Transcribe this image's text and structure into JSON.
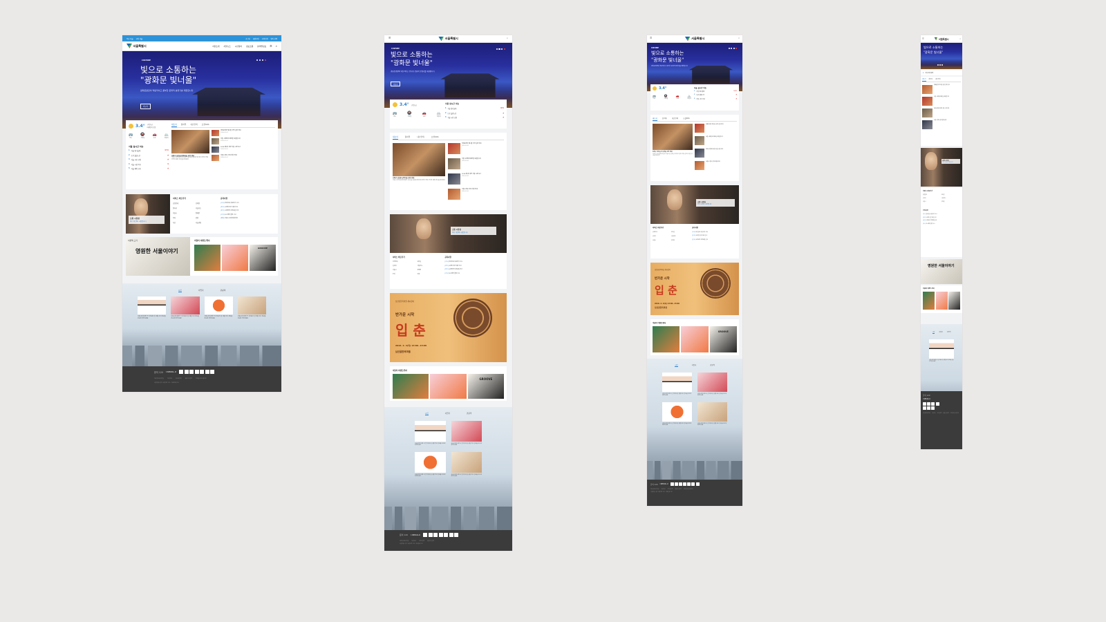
{
  "top_links": [
    "주요 서울",
    "국어 서울"
  ],
  "top_right_links": [
    "로그인",
    "회원가입",
    "사이트맵",
    "사이트맵",
    "언어 선택"
  ],
  "logo": "서울특별시",
  "gnb": [
    "서울소개",
    "서울뉴스",
    "시민참여",
    "정보소통",
    "분야별정보"
  ],
  "hero": {
    "tag": "CULTURE",
    "title_line1": "빛으로 소통하는",
    "title_line2": "\"광화문 빛너울\"",
    "desc": "광화문광장의 역동적이고 풍부한 문화적 분위기를 재현합니다",
    "button": "더보기"
  },
  "weather": {
    "temp": "3.4°",
    "desc": "구름조금",
    "detail": "미세먼지 보통"
  },
  "transport": [
    "버스",
    "지하철",
    "도로",
    "따릉이"
  ],
  "keywords": {
    "title": "서울 실시간 이슈",
    "items": [
      {
        "rank": "1",
        "text": "서울 빛너울제",
        "trend": "NEW"
      },
      {
        "rank": "2",
        "text": "도봉 출발노선",
        "trend": "▲"
      },
      {
        "rank": "3",
        "text": "서울 시민 공원",
        "trend": "▲"
      },
      {
        "rank": "4",
        "text": "서울 시청 복지",
        "trend": "▼"
      },
      {
        "rank": "5",
        "text": "서울 혜택 공유",
        "trend": "▲"
      }
    ]
  },
  "news_tabs": [
    "새소식",
    "참여톡",
    "내손안의",
    "소셜SNS"
  ],
  "news": {
    "main_caption": "송파구 남산골 한옥마을 공연 안내",
    "main_text": "서울시 남산골한옥마을은 2월 4일 입춘을 맞이해 다양한 전통 공연과 체험 행사를 준비했다",
    "items": [
      {
        "title": "광화문광장 빛너울 공연 일정 안내",
        "date": "2016.02.01"
      },
      {
        "title": "서울 시민참여 제안을 모집합니다",
        "date": "2016.02.01"
      },
      {
        "title": "2016 제1회 희망 서울 시정 보고",
        "date": "2016.02.01"
      },
      {
        "title": "서울시 정보 공개 현황 안내",
        "date": "2016.02.01"
      }
    ]
  },
  "mayor": {
    "label": "소통 시장실",
    "sub": "어디 이건의 시장입니다"
  },
  "services": {
    "title": "서비스 바로가기",
    "items": [
      "공연안내",
      "모바일",
      "일자리",
      "서울지도",
      "서울시",
      "장애인",
      "주차",
      "민원",
      "다산",
      "서울광장"
    ]
  },
  "notices": {
    "title": "공지사항",
    "items": [
      {
        "tag": "[고시]",
        "text": "한강공원 사용허가 고시"
      },
      {
        "tag": "[공고]",
        "text": "시민청 공간 대관 공고"
      },
      {
        "tag": "[공고]",
        "text": "시민안전 지역모집 공고"
      },
      {
        "tag": "[고시]",
        "text": "도시계획 결정 고시"
      },
      {
        "tag": "[입법]",
        "text": "서울시 조례 입법 예고"
      }
    ]
  },
  "book": {
    "label": "서울책 고가",
    "title": "영원한 서울이야기"
  },
  "ipchun": {
    "subtitle": "남산골한옥마을 세시맞이",
    "title": "반가운 시작",
    "big": "입 춘",
    "date": "2016. 2. 4(목) 13:00~15:00",
    "place": "남산골한옥마을"
  },
  "events": {
    "title": "이달의 이벤트/행사",
    "items": [
      "축제",
      "전시",
      "GROOVE"
    ]
  },
  "citizen_tabs": [
    "시민",
    "사업자",
    "관광객"
  ],
  "citizen_text": "서울시민이라면 꼭 알아둬야 할 생활 복지 정보를 한눈에 확인하세요",
  "footer": {
    "brand": "I·SEOUL·U",
    "call": "문의 120",
    "links": [
      "개인정보처리방침",
      "이용약관",
      "저작권정책",
      "웹접근성정책",
      "이메일무단수집거부"
    ],
    "copyright": "서울특별시 중구 세종대로 110 · 대표전화 120"
  }
}
